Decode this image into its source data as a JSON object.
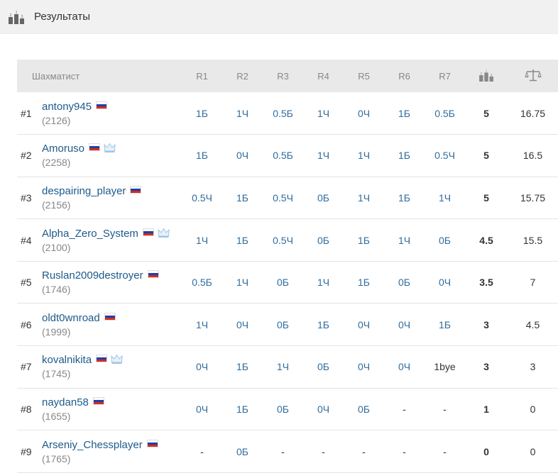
{
  "header": {
    "title": "Результаты",
    "icon": "podium-icon"
  },
  "table": {
    "columns": {
      "player": "Шахматист",
      "rounds": [
        "R1",
        "R2",
        "R3",
        "R4",
        "R5",
        "R6",
        "R7"
      ],
      "points_icon": "podium-icon",
      "tiebreak_icon": "scales-icon"
    },
    "rows": [
      {
        "rank": "#1",
        "name": "antony945",
        "rating": "(2126)",
        "crown": false,
        "results": [
          "1Б",
          "1Ч",
          "0.5Б",
          "1Ч",
          "0Ч",
          "1Б",
          "0.5Б"
        ],
        "points": "5",
        "tiebreak": "16.75"
      },
      {
        "rank": "#2",
        "name": "Amoruso",
        "rating": "(2258)",
        "crown": true,
        "results": [
          "1Б",
          "0Ч",
          "0.5Б",
          "1Ч",
          "1Ч",
          "1Б",
          "0.5Ч"
        ],
        "points": "5",
        "tiebreak": "16.5"
      },
      {
        "rank": "#3",
        "name": "despairing_player",
        "rating": "(2156)",
        "crown": false,
        "results": [
          "0.5Ч",
          "1Б",
          "0.5Ч",
          "0Б",
          "1Ч",
          "1Б",
          "1Ч"
        ],
        "points": "5",
        "tiebreak": "15.75"
      },
      {
        "rank": "#4",
        "name": "Alpha_Zero_System",
        "rating": "(2100)",
        "crown": true,
        "results": [
          "1Ч",
          "1Б",
          "0.5Ч",
          "0Б",
          "1Б",
          "1Ч",
          "0Б"
        ],
        "points": "4.5",
        "tiebreak": "15.5"
      },
      {
        "rank": "#5",
        "name": "Ruslan2009destroyer",
        "rating": "(1746)",
        "crown": false,
        "results": [
          "0.5Б",
          "1Ч",
          "0Б",
          "1Ч",
          "1Б",
          "0Б",
          "0Ч"
        ],
        "points": "3.5",
        "tiebreak": "7"
      },
      {
        "rank": "#6",
        "name": "oldt0wnroad",
        "rating": "(1999)",
        "crown": false,
        "results": [
          "1Ч",
          "0Ч",
          "0Б",
          "1Б",
          "0Ч",
          "0Ч",
          "1Б"
        ],
        "points": "3",
        "tiebreak": "4.5"
      },
      {
        "rank": "#7",
        "name": "kovalnikita",
        "rating": "(1745)",
        "crown": true,
        "results": [
          "0Ч",
          "1Б",
          "1Ч",
          "0Б",
          "0Ч",
          "0Ч",
          "1bye"
        ],
        "points": "3",
        "tiebreak": "3"
      },
      {
        "rank": "#8",
        "name": "naydan58",
        "rating": "(1655)",
        "crown": false,
        "results": [
          "0Ч",
          "1Б",
          "0Б",
          "0Ч",
          "0Б",
          "-",
          "-"
        ],
        "points": "1",
        "tiebreak": "0"
      },
      {
        "rank": "#9",
        "name": "Arseniy_Chessplayer",
        "rating": "(1765)",
        "crown": false,
        "results": [
          "-",
          "0Б",
          "-",
          "-",
          "-",
          "-",
          "-"
        ],
        "points": "0",
        "tiebreak": "0"
      }
    ]
  },
  "colors": {
    "link": "#1d5a8a",
    "result": "#2f6c9e",
    "header_bg": "#f1f1f1",
    "thead_bg": "#e9e9e9"
  }
}
